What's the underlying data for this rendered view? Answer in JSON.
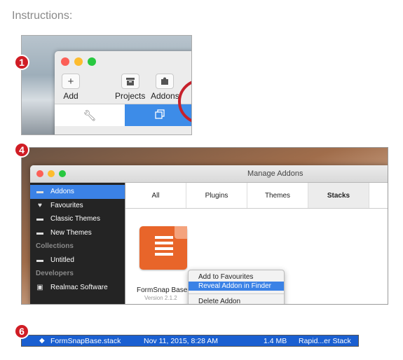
{
  "heading": "Instructions:",
  "steps": {
    "s1": "1",
    "s4": "4",
    "s6": "6"
  },
  "step1": {
    "toolbar": {
      "add": "Add",
      "projects": "Projects",
      "addons": "Addons"
    }
  },
  "step4": {
    "window_title": "Manage Addons",
    "sidebar": {
      "items": [
        "Addons",
        "Favourites",
        "Classic Themes",
        "New Themes"
      ],
      "collections_heading": "Collections",
      "collections": [
        "Untitled"
      ],
      "developers_heading": "Developers",
      "developers": [
        "Realmac Software"
      ]
    },
    "tabs": [
      "All",
      "Plugins",
      "Themes",
      "Stacks"
    ],
    "selected_tab": "Stacks",
    "addon": {
      "name": "FormSnap Base",
      "version": "Version 2.1.2"
    },
    "context_menu": [
      "Add to Favourites",
      "Reveal Addon in Finder",
      "Delete Addon"
    ]
  },
  "step6": {
    "filename": "FormSnapBase.stack",
    "date": "Nov 11, 2015, 8:28 AM",
    "size": "1.4 MB",
    "kind": "Rapid...er Stack"
  },
  "colors": {
    "badge": "#d01d25",
    "selection": "#3b82e6",
    "finder_row": "#1a5fd1"
  }
}
